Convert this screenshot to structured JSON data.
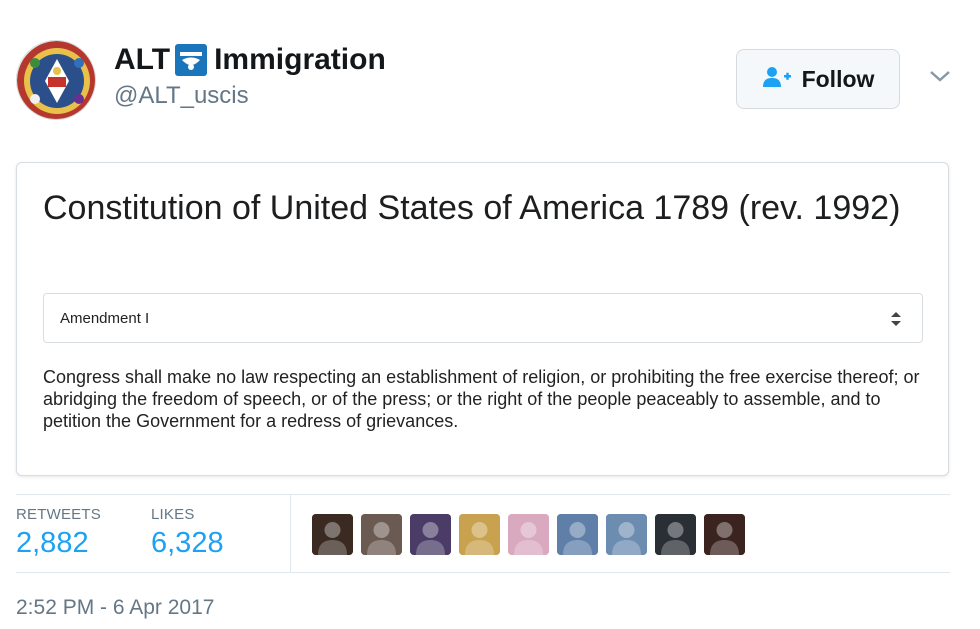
{
  "profile": {
    "name_part1": "ALT",
    "name_part2": "Immigration",
    "handle": "@ALT_uscis",
    "avatar_icon": "seal-icon",
    "name_icon": "uscis-logo-icon"
  },
  "follow_button": {
    "label": "Follow",
    "icon": "follow-person-icon",
    "color": "#1da1f2"
  },
  "card": {
    "title": "Constitution of United States of America 1789 (rev. 1992)",
    "select": {
      "value": "Amendment I"
    },
    "body": "Congress shall make no law respecting an establishment of religion, or prohibiting the free exercise thereof; or abridging the freedom of speech, or of the press; or the right of the people peaceably to assemble, and to petition the Government for a redress of grievances."
  },
  "stats": {
    "retweets_label": "RETWEETS",
    "retweets_value": "2,882",
    "likes_label": "LIKES",
    "likes_value": "6,328"
  },
  "likers": [
    "#3a2a22",
    "#6b5a52",
    "#4a3c66",
    "#c8a24e",
    "#d9a9c0",
    "#5f7fa8",
    "#6c8cb0",
    "#2a2f35",
    "#3b2420"
  ],
  "timestamp": "2:52 PM - 6 Apr 2017"
}
